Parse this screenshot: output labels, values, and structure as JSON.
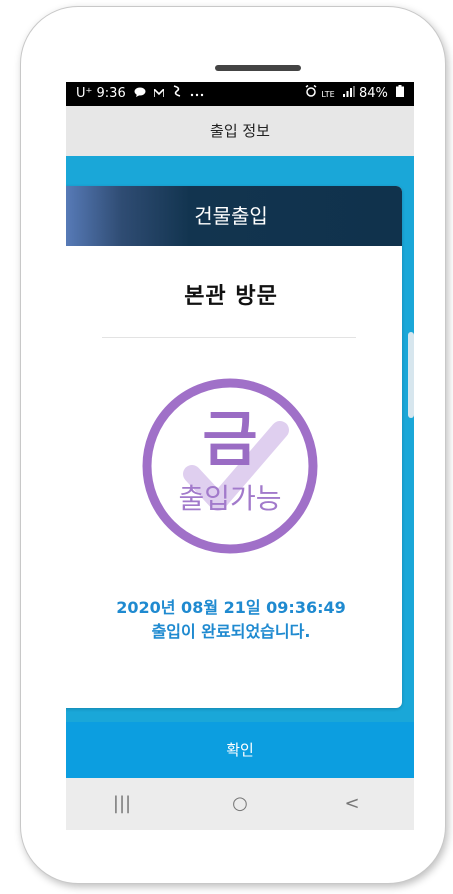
{
  "status_bar": {
    "carrier": "U⁺",
    "time": "9:36",
    "icons_left": [
      "chat-icon",
      "mail-icon",
      "notification-icon",
      "more-icon"
    ],
    "network": "LTE",
    "battery": "84%"
  },
  "app_bar": {
    "title": "출입 정보"
  },
  "card": {
    "header": "건물출입",
    "place": "본관  방문",
    "stamp": {
      "day": "금",
      "label": "출입가능",
      "color": "#a070c8"
    },
    "datetime": "2020년 08월 21일 09:36:49",
    "message": "출입이 완료되었습니다."
  },
  "confirm_button": {
    "label": "확인"
  },
  "nav": {
    "recent": "|||",
    "home": "○",
    "back": "<"
  },
  "colors": {
    "content_bg": "#1aa7d8",
    "button_bg": "#0c9ee0",
    "text_accent": "#1f8ad0",
    "header_dark": "#10324c"
  }
}
